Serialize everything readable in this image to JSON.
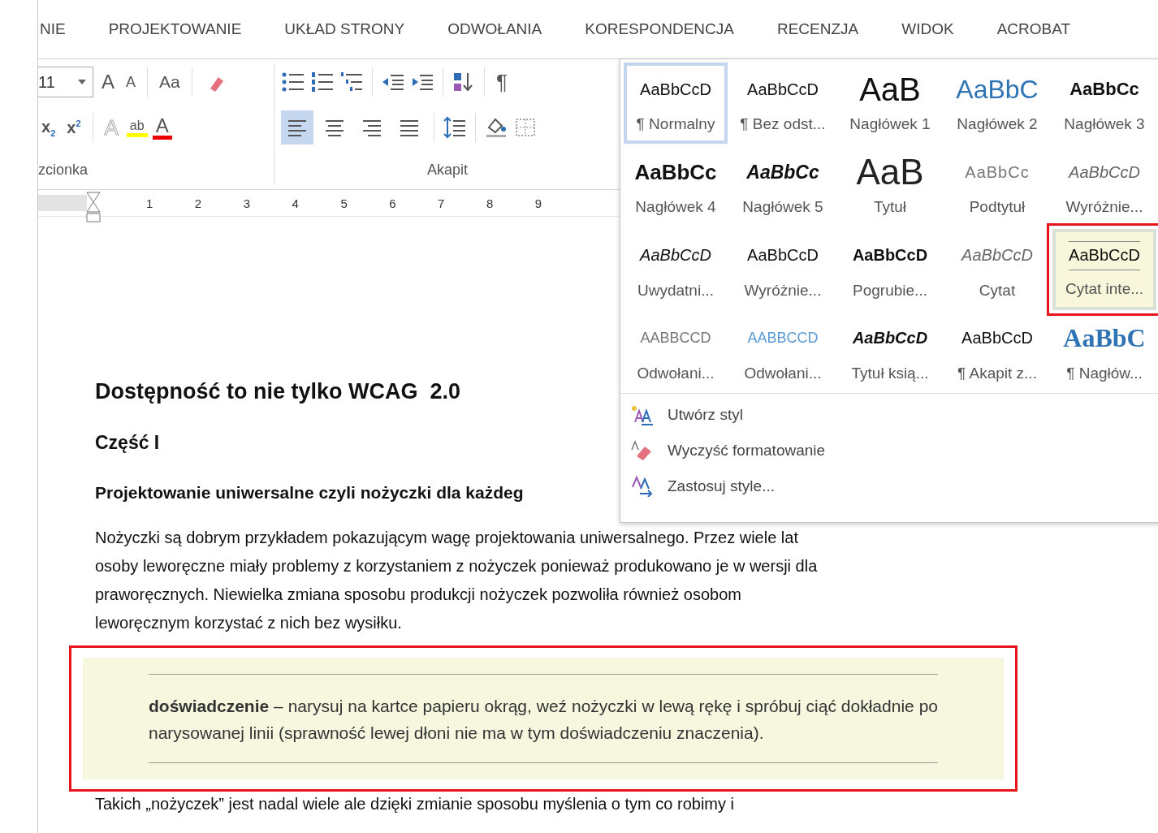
{
  "ribbon_tabs": [
    {
      "label": "NIE"
    },
    {
      "label": "PROJEKTOWANIE"
    },
    {
      "label": "UKŁAD STRONY"
    },
    {
      "label": "ODWOŁANIA"
    },
    {
      "label": "KORESPONDENCJA"
    },
    {
      "label": "RECENZJA"
    },
    {
      "label": "WIDOK"
    },
    {
      "label": "ACROBAT"
    }
  ],
  "font_group": {
    "font_size": "11",
    "grow_label": "A",
    "shrink_label": "A",
    "case_label": "Aa",
    "subscript_label": "x",
    "subscript_mark": "2",
    "superscript_label": "x",
    "superscript_mark": "2",
    "effects_label": "A",
    "highlight_label": "ab",
    "color_label": "A",
    "label": "zcionka"
  },
  "paragraph_group": {
    "label": "Akapit",
    "show_marks_label": "¶",
    "alignments": [
      {
        "kind": "left",
        "selected": true
      },
      {
        "kind": "center",
        "selected": false
      },
      {
        "kind": "right",
        "selected": false
      },
      {
        "kind": "justify",
        "selected": false
      }
    ]
  },
  "ruler": {
    "numbers": [
      "1",
      "2",
      "3",
      "4",
      "5",
      "6",
      "7",
      "8",
      "9"
    ]
  },
  "styles_gallery": {
    "items": [
      {
        "kind": "normal",
        "preview": "AaBbCcD",
        "label": "¶ Normalny",
        "selected": true,
        "hovered": false,
        "annotated": false
      },
      {
        "kind": "no-spacing",
        "preview": "AaBbCcD",
        "label": "¶ Bez odst...",
        "selected": false,
        "hovered": false,
        "annotated": false
      },
      {
        "kind": "heading1",
        "preview": "AaB",
        "label": "Nagłówek 1",
        "selected": false,
        "hovered": false,
        "annotated": false
      },
      {
        "kind": "heading2",
        "preview": "AaBbC",
        "label": "Nagłówek 2",
        "selected": false,
        "hovered": false,
        "annotated": false
      },
      {
        "kind": "heading3",
        "preview": "AaBbCc",
        "label": "Nagłówek 3",
        "selected": false,
        "hovered": false,
        "annotated": false
      },
      {
        "kind": "heading4",
        "preview": "AaBbCc",
        "label": "Nagłówek 4",
        "selected": false,
        "hovered": false,
        "annotated": false
      },
      {
        "kind": "heading5",
        "preview": "AaBbCc",
        "label": "Nagłówek 5",
        "selected": false,
        "hovered": false,
        "annotated": false
      },
      {
        "kind": "title",
        "preview": "AaB",
        "label": "Tytuł",
        "selected": false,
        "hovered": false,
        "annotated": false
      },
      {
        "kind": "subtitle",
        "preview": "AaBbCc",
        "label": "Podtytuł",
        "selected": false,
        "hovered": false,
        "annotated": false
      },
      {
        "kind": "subtle-emphasis",
        "preview": "AaBbCcD",
        "label": "Wyróżnie...",
        "selected": false,
        "hovered": false,
        "annotated": false
      },
      {
        "kind": "emphasis",
        "preview": "AaBbCcD",
        "label": "Uwydatni...",
        "selected": false,
        "hovered": false,
        "annotated": false
      },
      {
        "kind": "intense-emphasis",
        "preview": "AaBbCcD",
        "label": "Wyróżnie...",
        "selected": false,
        "hovered": false,
        "annotated": false
      },
      {
        "kind": "strong",
        "preview": "AaBbCcD",
        "label": "Pogrubie...",
        "selected": false,
        "hovered": false,
        "annotated": false
      },
      {
        "kind": "quote",
        "preview": "AaBbCcD",
        "label": "Cytat",
        "selected": false,
        "hovered": false,
        "annotated": false
      },
      {
        "kind": "intense-quote",
        "preview": "AaBbCcD",
        "label": "Cytat inte...",
        "selected": false,
        "hovered": true,
        "annotated": true
      },
      {
        "kind": "subtle-reference",
        "preview": "AABBCCD",
        "label": "Odwołani...",
        "selected": false,
        "hovered": false,
        "annotated": false
      },
      {
        "kind": "intense-reference",
        "preview": "AABBCCD",
        "label": "Odwołani...",
        "selected": false,
        "hovered": false,
        "annotated": false
      },
      {
        "kind": "book-title",
        "preview": "AaBbCcD",
        "label": "Tytuł ksią...",
        "selected": false,
        "hovered": false,
        "annotated": false
      },
      {
        "kind": "list-paragraph",
        "preview": "AaBbCcD",
        "label": "¶ Akapit z...",
        "selected": false,
        "hovered": false,
        "annotated": false
      },
      {
        "kind": "toc-heading",
        "preview": "AaBbC",
        "label": "¶ Nagłów...",
        "selected": false,
        "hovered": false,
        "annotated": false
      }
    ],
    "commands": [
      {
        "kind": "create",
        "label": "Utwórz styl"
      },
      {
        "kind": "clear",
        "label": "Wyczyść formatowanie"
      },
      {
        "kind": "apply",
        "label": "Zastosuj style..."
      }
    ]
  },
  "document": {
    "title": "Dostępność to nie tylko WCAG  2.0",
    "part": "Część I",
    "section_heading": "Projektowanie uniwersalne czyli nożyczki dla każdeg",
    "paragraph_lines": [
      "Nożyczki są dobrym przykładem pokazującym wagę projektowania uniwersalnego. Przez wiele lat",
      "osoby leworęczne miały problemy z korzystaniem z nożyczek ponieważ produkowano je w wersji dla",
      "praworęcznych. Niewielka zmiana sposobu produkcji nożyczek pozwoliła również osobom",
      "leworęcznym korzystać z nich bez wysiłku."
    ],
    "quote": {
      "text": "**doświadczenie** – narysuj na kartce papieru okrąg, weź nożyczki w lewą rękę i spróbuj ciąć dokładnie po narysowanej linii (sprawność lewej dłoni nie ma w tym doświadczeniu znaczenia).",
      "annotated": true
    },
    "last_line": "Takich „nożyczek” jest nadal wiele ale dzięki zmianie sposobu myślenia o tym co robimy i"
  }
}
